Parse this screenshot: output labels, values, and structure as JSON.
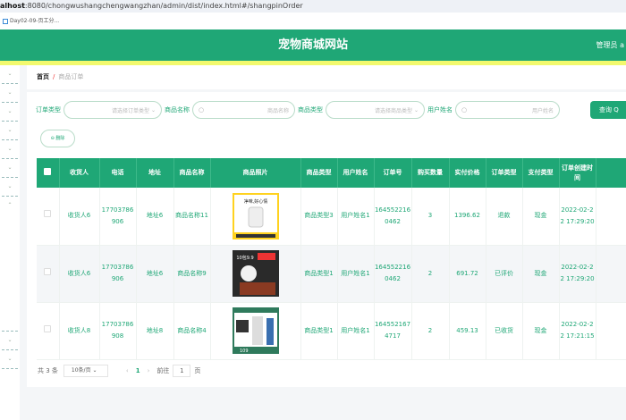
{
  "browser": {
    "url_host": "alhost",
    "url_rest": ":8080/chongwushangchengwangzhan/admin/dist/index.html#/shangpinOrder",
    "bookmark": "Day02-09-页工分..."
  },
  "header": {
    "title": "宠物商城网站",
    "user": "管理员 a"
  },
  "breadcrumb": {
    "home": "首页",
    "sep": "/",
    "current": "商品订单"
  },
  "search": {
    "order_type_label": "订单类型",
    "order_type_placeholder": "请选择订单类型",
    "product_name_label": "商品名称",
    "product_name_placeholder": "商品名称",
    "product_type_label": "商品类型",
    "product_type_placeholder": "请选择商品类型",
    "user_name_label": "用户姓名",
    "user_name_placeholder": "用户姓名",
    "query_label": "查询"
  },
  "actions": {
    "delete_label": "删除"
  },
  "table": {
    "headers": [
      "收货人",
      "电话",
      "地址",
      "商品名称",
      "商品照片",
      "商品类型",
      "用户姓名",
      "订单号",
      "购买数量",
      "实付价格",
      "订单类型",
      "支付类型",
      "订单创建时间"
    ],
    "rows": [
      {
        "receiver": "收货人6",
        "phone": "17703786906",
        "address": "地址6",
        "product_name": "商品名称11",
        "photo_text": "净味,好心情",
        "product_type": "商品类型3",
        "user_name": "用户姓名1",
        "order_no": "1645522160462",
        "quantity": "3",
        "price": "1396.62",
        "order_type": "退款",
        "pay_type": "现金",
        "created": "2022-02-22 17:29:20"
      },
      {
        "receiver": "收货人6",
        "phone": "17703786906",
        "address": "地址6",
        "product_name": "商品名称9",
        "photo_text": "10包9.9",
        "product_type": "商品类型1",
        "user_name": "用户姓名1",
        "order_no": "1645522160462",
        "quantity": "2",
        "price": "691.72",
        "order_type": "已评价",
        "pay_type": "现金",
        "created": "2022-02-22 17:29:20"
      },
      {
        "receiver": "收货人8",
        "phone": "17703786908",
        "address": "地址8",
        "product_name": "商品名称4",
        "photo_text": "109",
        "product_type": "商品类型1",
        "user_name": "用户姓名1",
        "order_no": "1645521674717",
        "quantity": "2",
        "price": "459.13",
        "order_type": "已收货",
        "pay_type": "现金",
        "created": "2022-02-22 17:21:15"
      }
    ]
  },
  "pager": {
    "total": "共 3 条",
    "page_size": "10条/页",
    "current_page": "1",
    "goto_label": "前往",
    "goto_value": "1",
    "page_unit": "页"
  },
  "colors": {
    "primary": "#1fa776",
    "stripe": "#f2f96d"
  }
}
